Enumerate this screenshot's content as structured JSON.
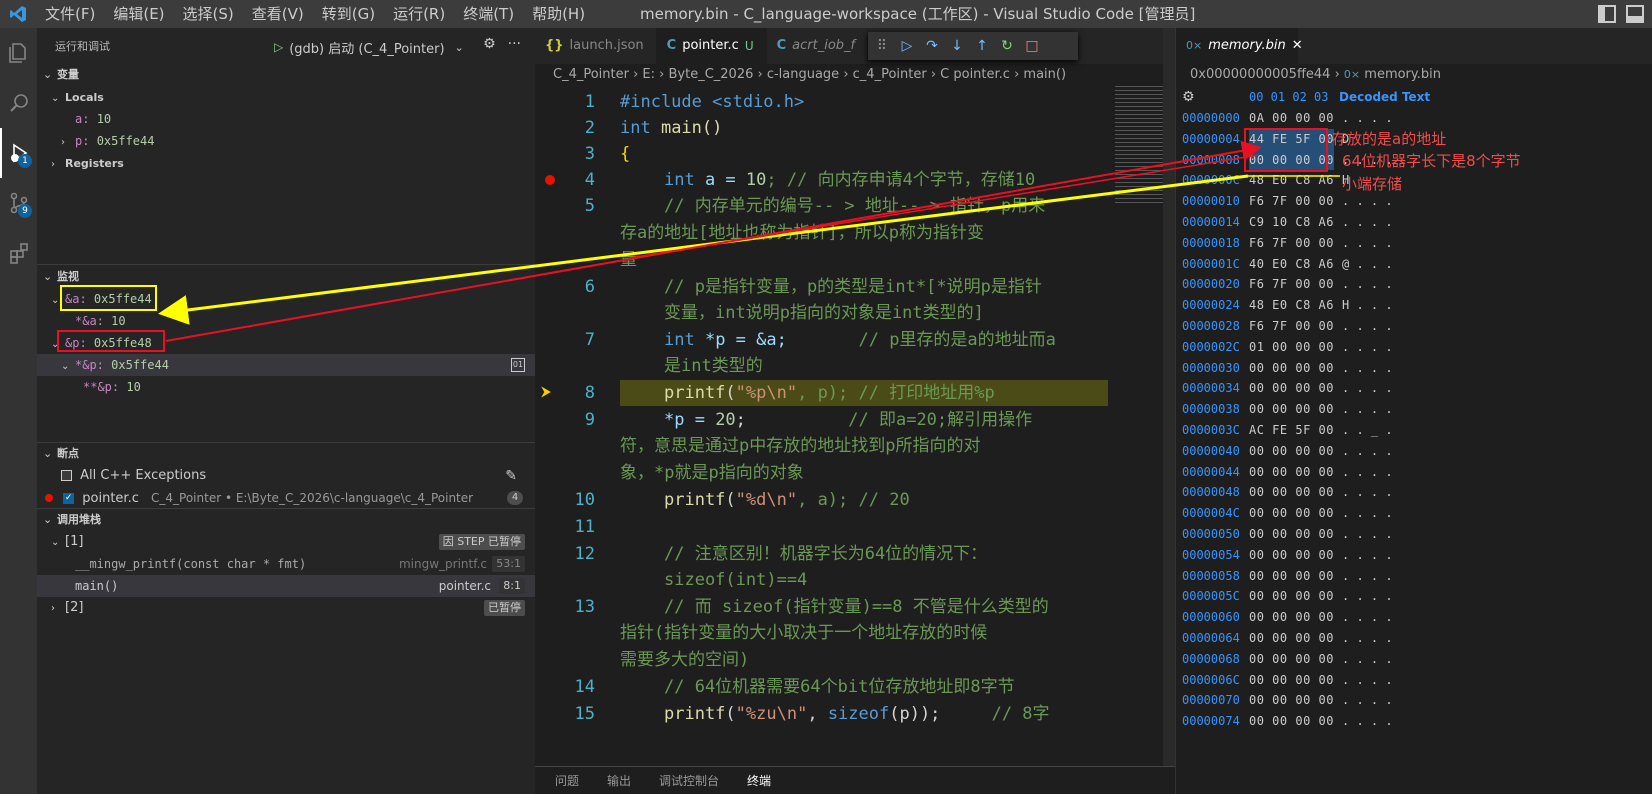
{
  "title": "memory.bin - C_language-workspace (工作区) - Visual Studio Code [管理员]",
  "menu": [
    "文件(F)",
    "编辑(E)",
    "选择(S)",
    "查看(V)",
    "转到(G)",
    "运行(R)",
    "终端(T)",
    "帮助(H)"
  ],
  "activity": {
    "debug_badge": "1",
    "scm_badge": "9"
  },
  "sidebar": {
    "header": "运行和调试",
    "config": "(gdb) 启动 (C_4_Pointer)",
    "variables": {
      "title": "变量",
      "locals": "Locals",
      "a_name": "a:",
      "a_val": "10",
      "p_name": "p:",
      "p_val": "0x5ffe44",
      "registers": "Registers"
    },
    "watch": {
      "title": "监视",
      "w1_name": "&a:",
      "w1_val": "0x5ffe44",
      "w1c_name": "*&a:",
      "w1c_val": "10",
      "w2_name": "&p:",
      "w2_val": "0x5ffe48",
      "w2c_name": "*&p:",
      "w2c_val": "0x5ffe44",
      "w2cc_name": "**&p:",
      "w2cc_val": "10"
    },
    "breakpoints": {
      "title": "断点",
      "exceptions": "All C++ Exceptions",
      "file": "pointer.c",
      "path": "C_4_Pointer • E:\\Byte_C_2026\\c-language\\c_4_Pointer",
      "line": "4"
    },
    "callstack": {
      "title": "调用堆栈",
      "t1": "[1]",
      "t1_status": "因 STEP 已暂停",
      "f1": "__mingw_printf(const char * fmt)",
      "f1_file": "mingw_printf.c",
      "f1_pos": "53:1",
      "f2": "main()",
      "f2_file": "pointer.c",
      "f2_pos": "8:1",
      "t2": "[2]",
      "t2_status": "已暂停"
    }
  },
  "editor": {
    "tabs": [
      {
        "label": "launch.json",
        "icon": "{}"
      },
      {
        "label": "pointer.c",
        "icon": "C",
        "mod": "U"
      },
      {
        "label": "acrt_iob_f",
        "icon": "C"
      }
    ],
    "breadcrumb": "C_4_Pointer › E: › Byte_C_2026 › c-language › c_4_Pointer › C pointer.c › main()",
    "line_numbers": [
      "1",
      "2",
      "3",
      "4",
      "5",
      "6",
      "7",
      "8",
      "9",
      "10",
      "11",
      "12",
      "13",
      "14",
      "15"
    ],
    "lines": {
      "l1": "#include <stdio.h>",
      "l2a": "int",
      "l2b": " main()",
      "l3": "{",
      "l4a": "int",
      "l4b": " a = ",
      "l4c": "10",
      "l4d": "; // 向内存申请4个字节，存储10",
      "l5a": "// 内存单元的编号-- > 地址-- > 指针，p用来",
      "l5b": "存a的地址[地址也称为指针]，所以p称为指针变",
      "l5c": "量",
      "l6a": "// p是指针变量，p的类型是int*[*说明p是指针",
      "l6b": "变量，int说明p指向的对象是int类型的]",
      "l7a": "int",
      "l7b": " *p = &a;",
      "l7c": "       // p里存的是a的地址而a",
      "l7d": "是int类型的",
      "l8a": "printf",
      "l8b": "(",
      "l8c": "\"%p\\n\"",
      "l8d": ", p); // 打印地址用%p",
      "l9a": "*p = ",
      "l9b": "20",
      "l9c": ";",
      "l9d": "          // 即a=20;解引用操作",
      "l9e": "符，意思是通过p中存放的地址找到p所指向的对",
      "l9f": "象，*p就是p指向的对象",
      "l10a": "printf",
      "l10b": "(",
      "l10c": "\"%d\\n\"",
      "l10d": ", a); // 20",
      "l12a": "// 注意区别！机器字长为64位的情况下：",
      "l12b": "sizeof(int)==4",
      "l13a": "// 而 sizeof(指针变量)==8 不管是什么类型的",
      "l13b": "指针(指针变量的大小取决于一个地址存放的时候",
      "l13c": "需要多大的空间)",
      "l14a": "// 64位机器需要64个bit位存放地址即8字节",
      "l15a": "printf",
      "l15b": "(",
      "l15c": "\"%zu\\n\"",
      "l15d": ", ",
      "l15e": "sizeof",
      "l15f": "(p));",
      "l15g": "     // 8字"
    },
    "panel_tabs": [
      "问题",
      "输出",
      "调试控制台",
      "终端"
    ]
  },
  "hex": {
    "tab": "memory.bin",
    "breadcrumb_addr": "0x00000000005ffe44",
    "breadcrumb_file": "memory.bin",
    "header_bytes": "00 01 02 03",
    "header_text": "Decoded Text",
    "rows": [
      {
        "addr": "00000000",
        "bytes": "0A 00 00 00",
        "text": ". . . ."
      },
      {
        "addr": "00000004",
        "bytes": "44 FE 5F 00",
        "text": "D"
      },
      {
        "addr": "00000008",
        "bytes": "00 00 00 00",
        "text": ". . . ."
      },
      {
        "addr": "0000000C",
        "bytes": "48 E0 C8 A6",
        "text": "H"
      },
      {
        "addr": "00000010",
        "bytes": "F6 7F 00 00",
        "text": ". . . ."
      },
      {
        "addr": "00000014",
        "bytes": "C9 10 C8 A6",
        "text": ". . . ."
      },
      {
        "addr": "00000018",
        "bytes": "F6 7F 00 00",
        "text": ". . . ."
      },
      {
        "addr": "0000001C",
        "bytes": "40 E0 C8 A6",
        "text": "@ . . ."
      },
      {
        "addr": "00000020",
        "bytes": "F6 7F 00 00",
        "text": ". . . ."
      },
      {
        "addr": "00000024",
        "bytes": "48 E0 C8 A6",
        "text": "H . . ."
      },
      {
        "addr": "00000028",
        "bytes": "F6 7F 00 00",
        "text": ". . . ."
      },
      {
        "addr": "0000002C",
        "bytes": "01 00 00 00",
        "text": ". . . ."
      },
      {
        "addr": "00000030",
        "bytes": "00 00 00 00",
        "text": ". . . ."
      },
      {
        "addr": "00000034",
        "bytes": "00 00 00 00",
        "text": ". . . ."
      },
      {
        "addr": "00000038",
        "bytes": "00 00 00 00",
        "text": ". . . ."
      },
      {
        "addr": "0000003C",
        "bytes": "AC FE 5F 00",
        "text": ". . _ ."
      },
      {
        "addr": "00000040",
        "bytes": "00 00 00 00",
        "text": ". . . ."
      },
      {
        "addr": "00000044",
        "bytes": "00 00 00 00",
        "text": ". . . ."
      },
      {
        "addr": "00000048",
        "bytes": "00 00 00 00",
        "text": ". . . ."
      },
      {
        "addr": "0000004C",
        "bytes": "00 00 00 00",
        "text": ". . . ."
      },
      {
        "addr": "00000050",
        "bytes": "00 00 00 00",
        "text": ". . . ."
      },
      {
        "addr": "00000054",
        "bytes": "00 00 00 00",
        "text": ". . . ."
      },
      {
        "addr": "00000058",
        "bytes": "00 00 00 00",
        "text": ". . . ."
      },
      {
        "addr": "0000005C",
        "bytes": "00 00 00 00",
        "text": ". . . ."
      },
      {
        "addr": "00000060",
        "bytes": "00 00 00 00",
        "text": ". . . ."
      },
      {
        "addr": "00000064",
        "bytes": "00 00 00 00",
        "text": ". . . ."
      },
      {
        "addr": "00000068",
        "bytes": "00 00 00 00",
        "text": ". . . ."
      },
      {
        "addr": "0000006C",
        "bytes": "00 00 00 00",
        "text": ". . . ."
      },
      {
        "addr": "00000070",
        "bytes": "00 00 00 00",
        "text": ". . . ."
      },
      {
        "addr": "00000074",
        "bytes": "00 00 00 00",
        "text": ". . . ."
      }
    ]
  },
  "annotations": {
    "note1": "存放的是a的地址",
    "note2": "64位机器字长下是8个字节",
    "note3": "小端存储"
  },
  "colors": {
    "yellow": "#ffff00",
    "red": "#e81123"
  }
}
